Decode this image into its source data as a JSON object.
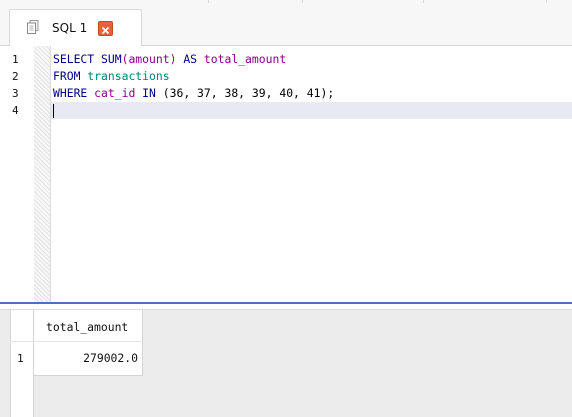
{
  "editor_tab": {
    "label": "SQL 1"
  },
  "editor": {
    "line_numbers": [
      "1",
      "2",
      "3",
      "4"
    ],
    "lines": [
      [
        {
          "text": "SELECT",
          "kind": "kw"
        },
        {
          "text": " ",
          "kind": "txt"
        },
        {
          "text": "SUM",
          "kind": "kw"
        },
        {
          "text": "(amount)",
          "kind": "fn"
        },
        {
          "text": " ",
          "kind": "txt"
        },
        {
          "text": "AS",
          "kind": "kw"
        },
        {
          "text": " ",
          "kind": "txt"
        },
        {
          "text": "total_amount",
          "kind": "fn"
        }
      ],
      [
        {
          "text": "FROM",
          "kind": "kw"
        },
        {
          "text": " ",
          "kind": "txt"
        },
        {
          "text": "transactions",
          "kind": "id"
        }
      ],
      [
        {
          "text": "WHERE",
          "kind": "kw"
        },
        {
          "text": " ",
          "kind": "txt"
        },
        {
          "text": "cat_id",
          "kind": "fn"
        },
        {
          "text": " ",
          "kind": "txt"
        },
        {
          "text": "IN",
          "kind": "kw"
        },
        {
          "text": " (36, 37, 38, 39, 40, 41);",
          "kind": "num"
        }
      ],
      []
    ]
  },
  "results": {
    "columns": [
      "total_amount"
    ],
    "rows": [
      {
        "row_number": "1",
        "values": [
          "279002.0"
        ]
      }
    ]
  },
  "colors": {
    "keyword": "#00008b",
    "function_or_column": "#880088",
    "table_identifier": "#008080",
    "close_button": "#e8613c",
    "current_line": "#e9e9f3",
    "splitter_accent": "#4b73b5"
  },
  "icons": {
    "tab_icon": "sql-document-icon",
    "close_icon": "close-icon"
  }
}
